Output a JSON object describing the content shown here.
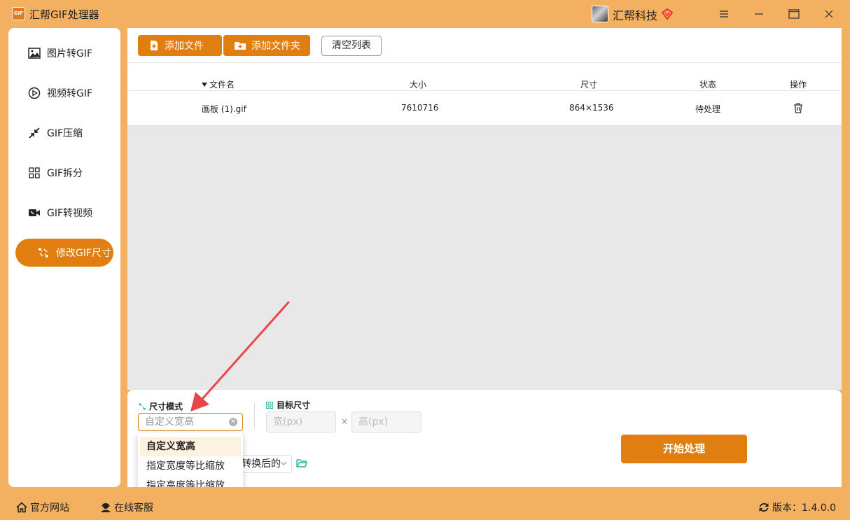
{
  "app": {
    "logo_text": "GIF",
    "title": "汇帮GIF处理器"
  },
  "user": {
    "name": "汇帮科技"
  },
  "sidebar": {
    "items": [
      {
        "label": "图片转GIF",
        "icon": "image-icon"
      },
      {
        "label": "视频转GIF",
        "icon": "play-icon"
      },
      {
        "label": "GIF压缩",
        "icon": "compress-icon"
      },
      {
        "label": "GIF拆分",
        "icon": "split-icon"
      },
      {
        "label": "GIF转视频",
        "icon": "video-camera-icon"
      },
      {
        "label": "修改GIF尺寸",
        "icon": "resize-icon",
        "active": true
      }
    ]
  },
  "toolbar": {
    "add_file": "添加文件",
    "add_folder": "添加文件夹",
    "clear_list": "清空列表"
  },
  "table": {
    "headers": [
      "文件名",
      "大小",
      "尺寸",
      "状态",
      "操作"
    ],
    "rows": [
      {
        "name": "画板 (1).gif",
        "size": "7610716",
        "dimensions": "864×1536",
        "status": "待处理",
        "action_icon": "trash-icon"
      }
    ]
  },
  "settings": {
    "size_mode_label": "尺寸模式",
    "size_mode_placeholder": "自定义宽高",
    "target_size_label": "目标尺寸",
    "width_placeholder": "宽(px)",
    "height_placeholder": "高(px)",
    "times_symbol": "×",
    "output_select_value": "转换后的",
    "start_button": "开始处理"
  },
  "dropdown": {
    "options": [
      "自定义宽高",
      "指定宽度等比缩放",
      "指定高度等比缩放"
    ],
    "selected_index": 0
  },
  "statusbar": {
    "website": "官方网站",
    "support": "在线客服",
    "version": "版本：1.4.0.0"
  },
  "colors": {
    "accent": "#e07e10",
    "background": "#f2b060",
    "arrow": "#e8474a"
  }
}
